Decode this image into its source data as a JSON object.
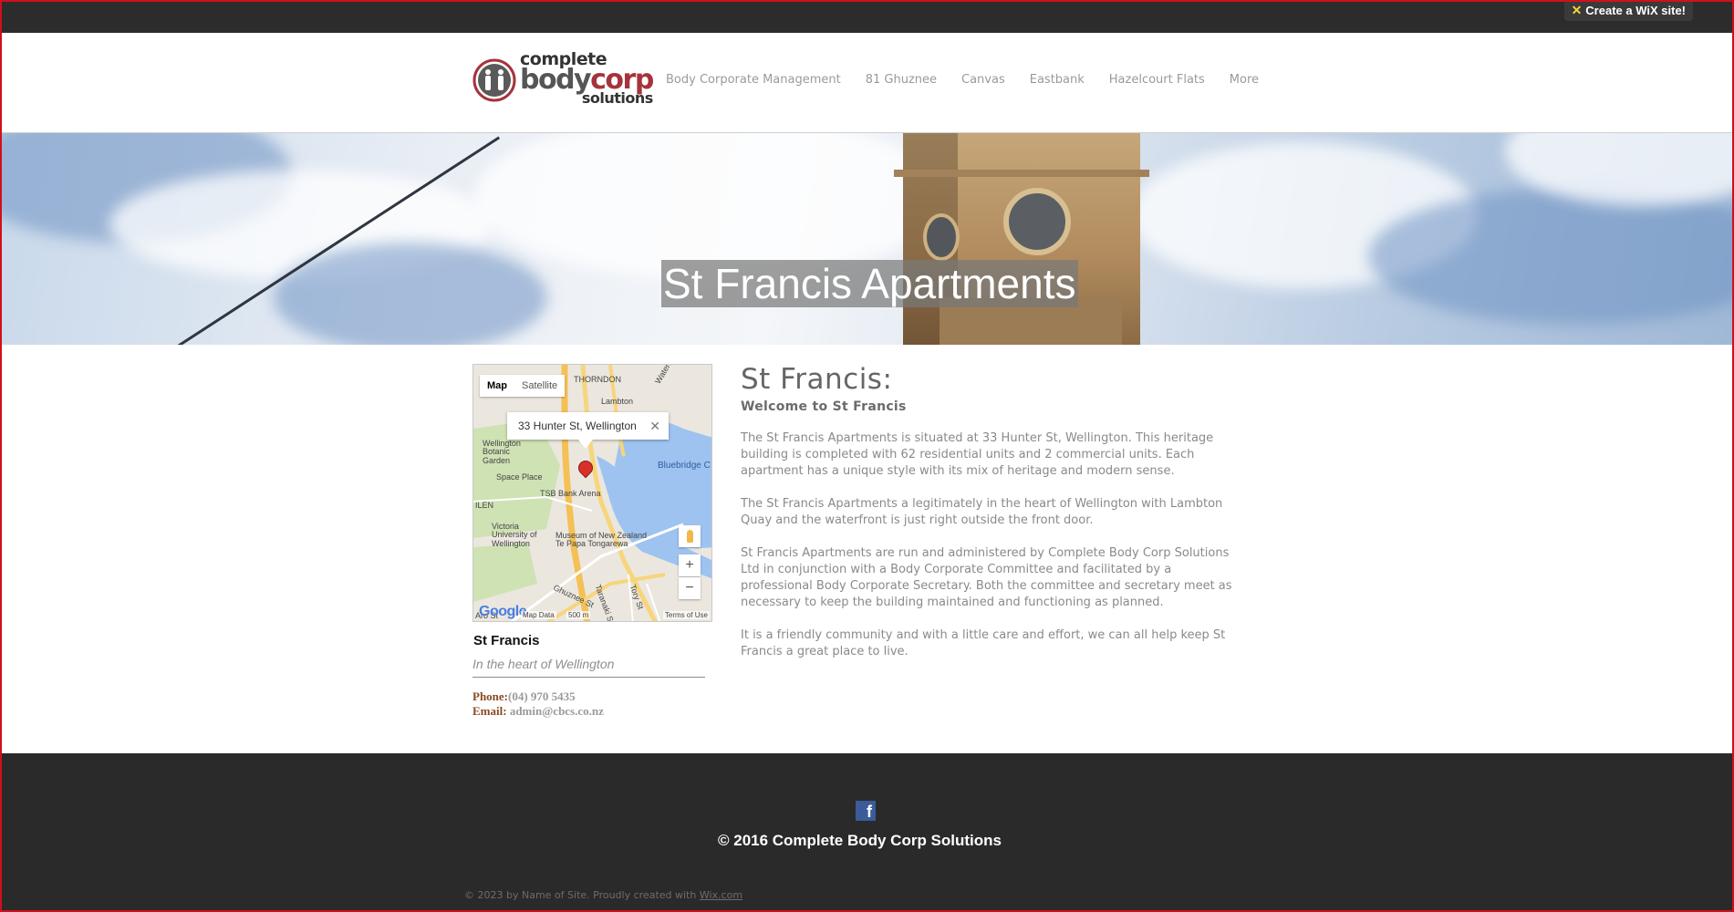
{
  "wix_badge": {
    "label": "Create a WiX site!",
    "icon": "star-icon"
  },
  "logo": {
    "line1": "complete",
    "line2a": "body",
    "line2b": "corp",
    "line3": "solutions"
  },
  "nav": {
    "items": [
      "Body Corporate Management",
      "81 Ghuznee",
      "Canvas",
      "Eastbank",
      "Hazelcourt Flats",
      "More"
    ]
  },
  "hero": {
    "title": "St Francis Apartments"
  },
  "map": {
    "tabs": [
      "Map",
      "Satellite"
    ],
    "popup": "33 Hunter St, Wellington",
    "labels": {
      "thorndon": "THORNDON",
      "lambton": "Lambton",
      "quay": "Waterloo Quay",
      "botanic": "Wellington\nBotanic\nGarden",
      "space": "Space Place",
      "tsb": "TSB Bank Arena",
      "bluebridge": "Bluebridge C",
      "victoria": "Victoria\nUniversity of\nWellington",
      "museum": "Museum of New Zealand\nTe Papa Tongarewa",
      "ilen": "ILEN",
      "ghuznee": "Ghuznee St",
      "taranaki": "Taranaki St",
      "tory": "Tory St",
      "aro": "Aro St"
    },
    "zoom_in": "+",
    "zoom_out": "−",
    "google": "Google",
    "map_data": "Map Data",
    "scale": "500 m",
    "terms": "Terms of Use"
  },
  "card": {
    "title": "St Francis",
    "subtitle": "In the heart of Wellington",
    "phone_label": "Phone:",
    "phone": "(04) 970 5435",
    "email_label": "Email:",
    "email": "admin@cbcs.co.nz"
  },
  "content": {
    "heading": "St Francis:",
    "subheading": "Welcome to St Francis",
    "paragraphs": [
      "The St Francis Apartments is situated at 33 Hunter St, Wellington. This heritage building is completed with 62 residential units and 2 commercial units. Each apartment has a unique style with its mix of heritage and modern sense.",
      "The St Francis Apartments a legitimately in the heart of Wellington with Lambton Quay and the waterfront is just right outside the front door.",
      "St Francis Apartments are run and administered by Complete Body Corp Solutions Ltd in conjunction with a Body Corporate Committee and facilitated by a professional Body Corporate Secretary. Both the committee and secretary meet as necessary to keep the building maintained and functioning as planned.",
      "It is a friendly community and with a little care and effort, we can all help keep St Francis a great place to live."
    ]
  },
  "footer": {
    "facebook": "f",
    "copyright": "© 2016 Complete Body Corp Solutions",
    "credit_prefix": "© 2023 by Name of Site. Proudly created with ",
    "credit_link": "Wix.com"
  },
  "colors": {
    "topbar": "#2c2c2c",
    "footer": "#2a2a2a",
    "accent": "#a5333b",
    "frame": "#d0101a"
  }
}
